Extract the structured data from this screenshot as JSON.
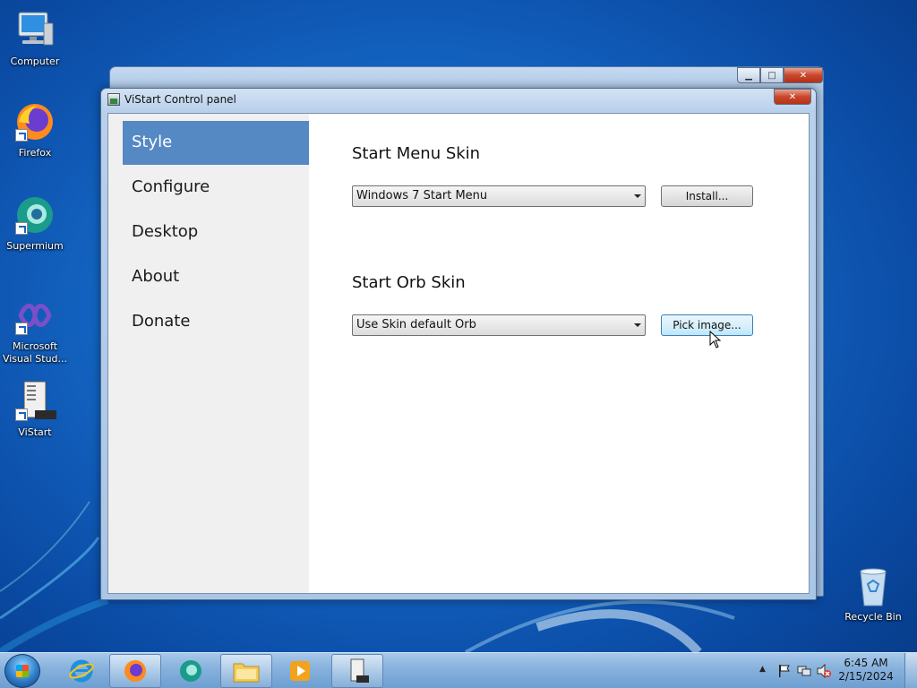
{
  "desktop": {
    "icons": [
      {
        "label": "Computer",
        "icon": "computer-icon"
      },
      {
        "label": "Firefox",
        "icon": "firefox-icon"
      },
      {
        "label": "Supermium",
        "icon": "supermium-icon"
      },
      {
        "label": "Microsoft Visual Stud...",
        "icon": "visual-studio-icon"
      },
      {
        "label": "ViStart",
        "icon": "vistart-icon"
      },
      {
        "label": "Recycle Bin",
        "icon": "recycle-bin-icon"
      }
    ]
  },
  "window": {
    "title": "ViStart Control panel",
    "close_glyph": "✕",
    "sidebar": {
      "items": [
        {
          "label": "Style",
          "active": true
        },
        {
          "label": "Configure",
          "active": false
        },
        {
          "label": "Desktop",
          "active": false
        },
        {
          "label": "About",
          "active": false
        },
        {
          "label": "Donate",
          "active": false
        }
      ]
    },
    "start_menu_skin": {
      "title": "Start Menu Skin",
      "selected": "Windows 7 Start Menu",
      "button_label": "Install..."
    },
    "start_orb_skin": {
      "title": "Start Orb Skin",
      "selected": "Use Skin default Orb",
      "button_label": "Pick image..."
    }
  },
  "background_window": {
    "min_glyph": "▁",
    "max_glyph": "□",
    "close_glyph": "✕"
  },
  "taskbar": {
    "clock_time": "6:45 AM",
    "clock_date": "2/15/2024",
    "tray_expand_glyph": "▲"
  },
  "colors": {
    "accent_nav": "#5589c4",
    "desktop_blue": "#1466c4"
  }
}
